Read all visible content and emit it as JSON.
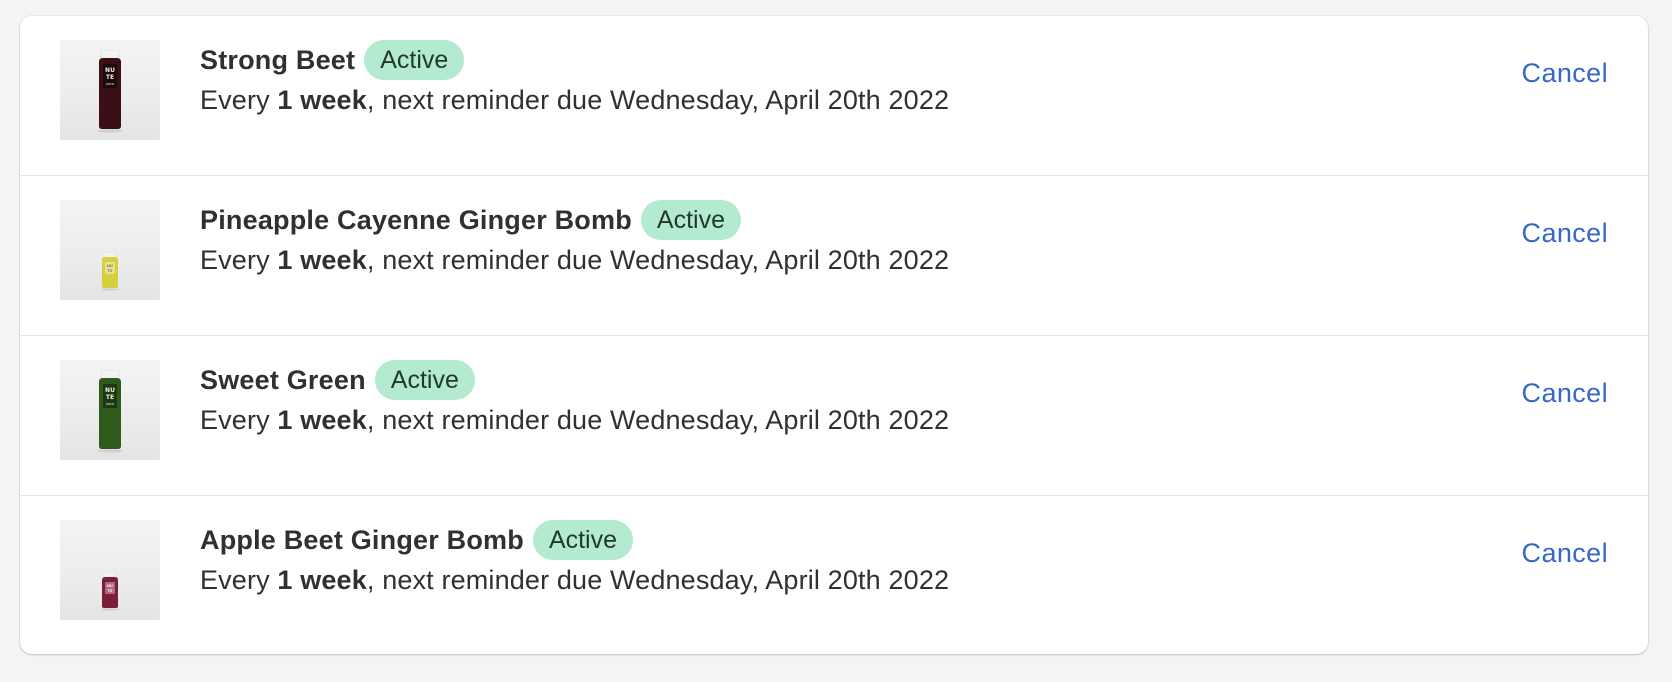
{
  "subscriptions": [
    {
      "name": "Strong Beet",
      "status": "Active",
      "schedule_prefix": "Every ",
      "interval": "1 week",
      "schedule_suffix": ", next reminder due Wednesday, April 20th 2022",
      "cancel_label": "Cancel",
      "bottle_color": "#3a0f16",
      "image_label": "NU TE juice"
    },
    {
      "name": "Pineapple Cayenne Ginger Bomb",
      "status": "Active",
      "schedule_prefix": "Every ",
      "interval": "1 week",
      "schedule_suffix": ", next reminder due Wednesday, April 20th 2022",
      "cancel_label": "Cancel",
      "bottle_color": "#d6cf3c",
      "image_label": "NU TE"
    },
    {
      "name": "Sweet Green",
      "status": "Active",
      "schedule_prefix": "Every ",
      "interval": "1 week",
      "schedule_suffix": ", next reminder due Wednesday, April 20th 2022",
      "cancel_label": "Cancel",
      "bottle_color": "#2e5a1c",
      "image_label": "NU TE juice"
    },
    {
      "name": "Apple Beet Ginger Bomb",
      "status": "Active",
      "schedule_prefix": "Every ",
      "interval": "1 week",
      "schedule_suffix": ", next reminder due Wednesday, April 20th 2022",
      "cancel_label": "Cancel",
      "bottle_color": "#7a1e3a",
      "image_label": "NU TE"
    }
  ],
  "colors": {
    "badge_bg": "#b4ead0",
    "link": "#3569c6"
  }
}
